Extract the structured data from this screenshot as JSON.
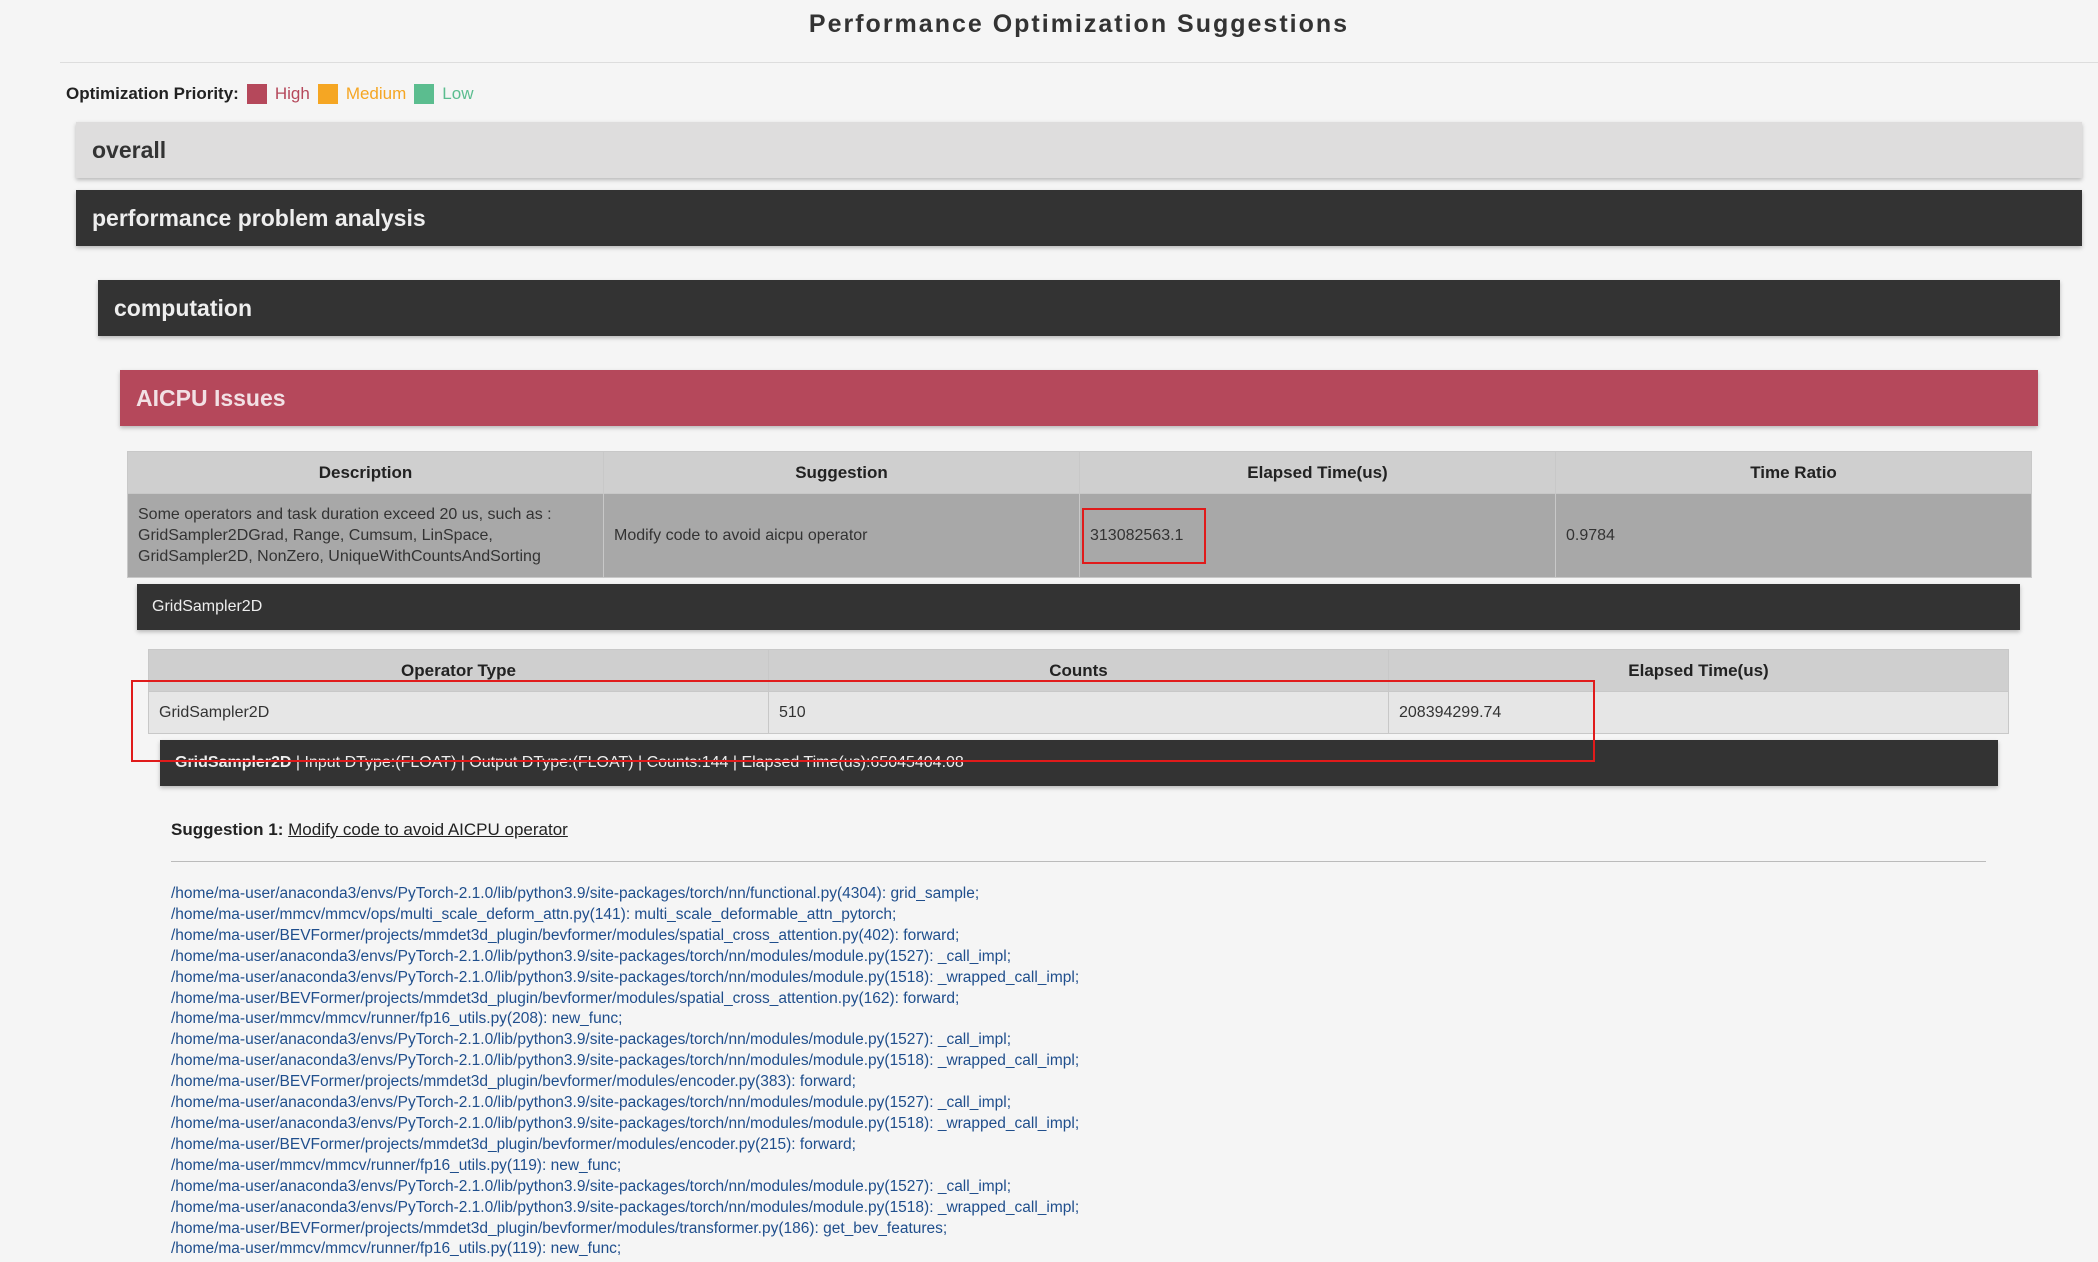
{
  "page": {
    "title": "Performance Optimization Suggestions"
  },
  "legend": {
    "label": "Optimization Priority:",
    "items": [
      {
        "label": "High",
        "color": "#b5485b"
      },
      {
        "label": "Medium",
        "color": "#f5a623"
      },
      {
        "label": "Low",
        "color": "#5bbd8f"
      }
    ]
  },
  "sections": {
    "overall": "overall",
    "analysis": "performance problem analysis",
    "computation": "computation",
    "aicpu": "AICPU Issues"
  },
  "aicpu_table": {
    "headers": [
      "Description",
      "Suggestion",
      "Elapsed Time(us)",
      "Time Ratio"
    ],
    "row": {
      "description": "Some operators and task duration exceed 20 us, such as : GridSampler2DGrad, Range, Cumsum, LinSpace, GridSampler2D, NonZero, UniqueWithCountsAndSorting",
      "suggestion": "Modify code to avoid aicpu operator",
      "elapsed": "313082563.1",
      "ratio": "0.9784"
    }
  },
  "operator_section": {
    "title": "GridSampler2D",
    "headers": [
      "Operator Type",
      "Counts",
      "Elapsed Time(us)"
    ],
    "row": {
      "type": "GridSampler2D",
      "counts": "510",
      "elapsed": "208394299.74"
    },
    "detail": {
      "name": "GridSampler2D",
      "info": " | Input DType:(FLOAT) | Output DType:(FLOAT) | Counts:144 | Elapsed Time(us):65045404.08"
    }
  },
  "suggestion": {
    "label": "Suggestion 1:",
    "link": "Modify code to avoid AICPU operator"
  },
  "stack": [
    "/home/ma-user/anaconda3/envs/PyTorch-2.1.0/lib/python3.9/site-packages/torch/nn/functional.py(4304): grid_sample;",
    "/home/ma-user/mmcv/mmcv/ops/multi_scale_deform_attn.py(141): multi_scale_deformable_attn_pytorch;",
    "/home/ma-user/BEVFormer/projects/mmdet3d_plugin/bevformer/modules/spatial_cross_attention.py(402): forward;",
    "/home/ma-user/anaconda3/envs/PyTorch-2.1.0/lib/python3.9/site-packages/torch/nn/modules/module.py(1527): _call_impl;",
    "/home/ma-user/anaconda3/envs/PyTorch-2.1.0/lib/python3.9/site-packages/torch/nn/modules/module.py(1518): _wrapped_call_impl;",
    "/home/ma-user/BEVFormer/projects/mmdet3d_plugin/bevformer/modules/spatial_cross_attention.py(162): forward;",
    "/home/ma-user/mmcv/mmcv/runner/fp16_utils.py(208): new_func;",
    "/home/ma-user/anaconda3/envs/PyTorch-2.1.0/lib/python3.9/site-packages/torch/nn/modules/module.py(1527): _call_impl;",
    "/home/ma-user/anaconda3/envs/PyTorch-2.1.0/lib/python3.9/site-packages/torch/nn/modules/module.py(1518): _wrapped_call_impl;",
    "/home/ma-user/BEVFormer/projects/mmdet3d_plugin/bevformer/modules/encoder.py(383): forward;",
    "/home/ma-user/anaconda3/envs/PyTorch-2.1.0/lib/python3.9/site-packages/torch/nn/modules/module.py(1527): _call_impl;",
    "/home/ma-user/anaconda3/envs/PyTorch-2.1.0/lib/python3.9/site-packages/torch/nn/modules/module.py(1518): _wrapped_call_impl;",
    "/home/ma-user/BEVFormer/projects/mmdet3d_plugin/bevformer/modules/encoder.py(215): forward;",
    "/home/ma-user/mmcv/mmcv/runner/fp16_utils.py(119): new_func;",
    "/home/ma-user/anaconda3/envs/PyTorch-2.1.0/lib/python3.9/site-packages/torch/nn/modules/module.py(1527): _call_impl;",
    "/home/ma-user/anaconda3/envs/PyTorch-2.1.0/lib/python3.9/site-packages/torch/nn/modules/module.py(1518): _wrapped_call_impl;",
    "/home/ma-user/BEVFormer/projects/mmdet3d_plugin/bevformer/modules/transformer.py(186): get_bev_features;",
    "/home/ma-user/mmcv/mmcv/runner/fp16_utils.py(119): new_func;"
  ]
}
